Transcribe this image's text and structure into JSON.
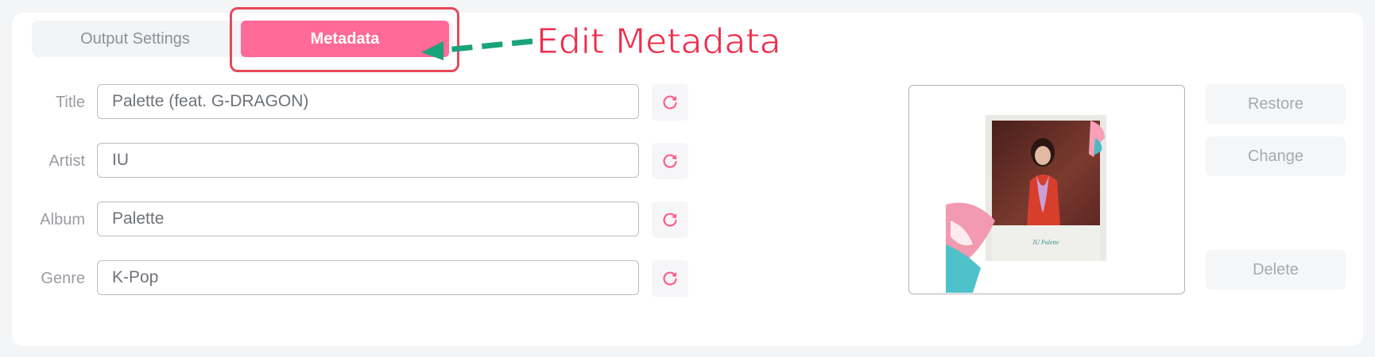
{
  "tabs": {
    "output_settings": "Output Settings",
    "metadata": "Metadata"
  },
  "annotation": {
    "text": "Edit Metadata"
  },
  "fields": {
    "title": {
      "label": "Title",
      "value": "Palette (feat. G-DRAGON)"
    },
    "artist": {
      "label": "Artist",
      "value": "IU"
    },
    "album": {
      "label": "Album",
      "value": "Palette"
    },
    "genre": {
      "label": "Genre",
      "value": "K-Pop"
    }
  },
  "cover": {
    "caption": "IU Palette"
  },
  "buttons": {
    "restore": "Restore",
    "change": "Change",
    "delete": "Delete"
  },
  "colors": {
    "accent": "#ff6a98",
    "annotation_red": "#ef2d4b",
    "arrow_green": "#1aa37a"
  },
  "icons": {
    "refresh": "refresh-icon",
    "arrow": "arrow-left-icon"
  }
}
